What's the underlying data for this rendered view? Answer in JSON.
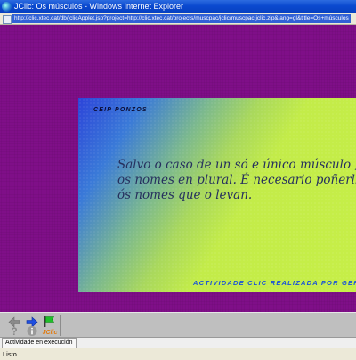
{
  "window": {
    "title": "JClic: Os músculos - Windows Internet Explorer"
  },
  "address_bar": {
    "url": "http://clic.xtec.cat/db/jclicApplet.jsp?project=http://clic.xtec.cat/projects/muscpac/jclic/muscpac.jclic.zip&lang=gl&title=Os+músculos"
  },
  "activity": {
    "school": "CEIP PONZOS",
    "message_lines": [
      "Salvo o caso de un só e único músculo ,  po",
      "os nomes en plural. É necesario poñerlle-lo",
      "ós nomes que o levan."
    ],
    "credits": "ACTIVIDADE CLIC REALIZADA POR GER",
    "colors": {
      "stage_background": "#7f0f88",
      "gradient_start": "#2c44d9",
      "gradient_end": "#c7ef47",
      "text": "#26305e",
      "credits": "#1a52d8"
    }
  },
  "toolbar": {
    "buttons": [
      {
        "name": "previous",
        "icon": "arrow-left-icon"
      },
      {
        "name": "next",
        "icon": "arrow-right-icon"
      },
      {
        "name": "reset",
        "icon": "green-flag-icon"
      },
      {
        "name": "help",
        "icon": "question-icon"
      },
      {
        "name": "info",
        "icon": "info-icon"
      },
      {
        "name": "about",
        "icon": "jclic-logo-icon",
        "label": "JClic"
      }
    ]
  },
  "status": {
    "activity_status": "Actividade en execución",
    "browser_status": "Listo"
  }
}
